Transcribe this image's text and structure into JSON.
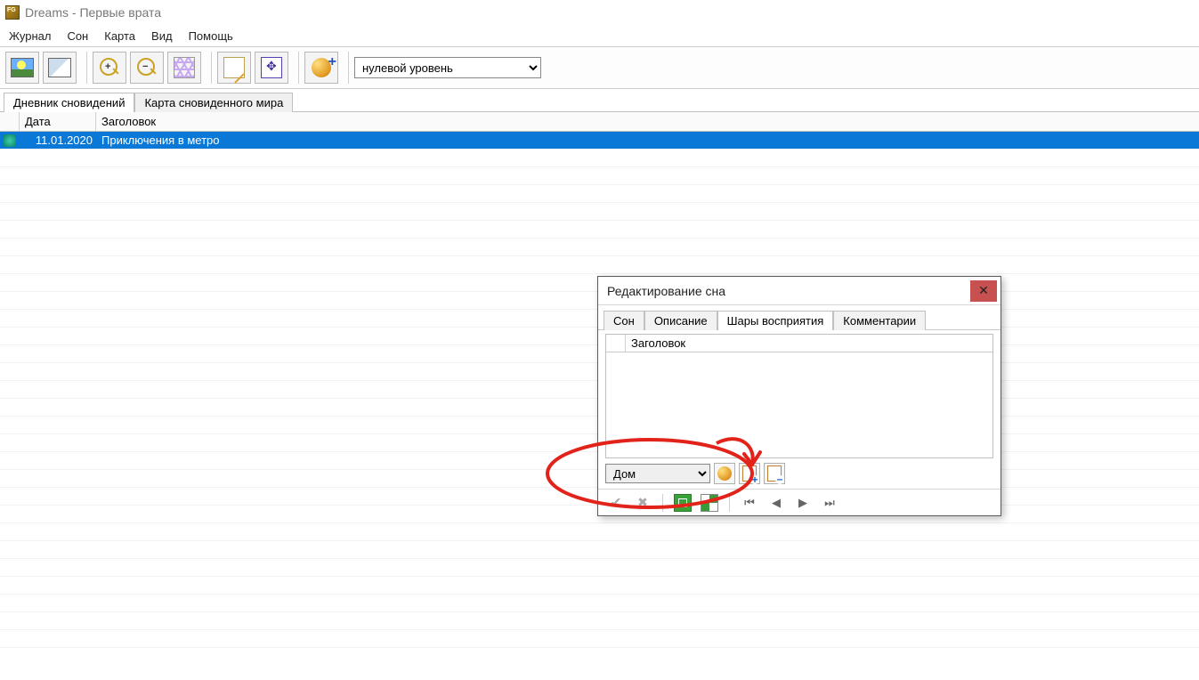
{
  "app": {
    "title": "Dreams - Первые врата"
  },
  "menu": {
    "items": [
      "Журнал",
      "Сон",
      "Карта",
      "Вид",
      "Помощь"
    ]
  },
  "toolbar": {
    "level_select": "нулевой уровень"
  },
  "main_tabs": {
    "items": [
      "Дневник сновидений",
      "Карта сновиденного мира"
    ],
    "active": 0
  },
  "table": {
    "headers": {
      "date": "Дата",
      "title": "Заголовок"
    },
    "rows": [
      {
        "date": "11.01.2020",
        "title": "Приключения в метро"
      }
    ]
  },
  "dialog": {
    "title": "Редактирование сна",
    "tabs": [
      "Сон",
      "Описание",
      "Шары восприятия",
      "Комментарии"
    ],
    "active_tab": 2,
    "grid_header": "Заголовок",
    "combo_value": "Дом"
  }
}
